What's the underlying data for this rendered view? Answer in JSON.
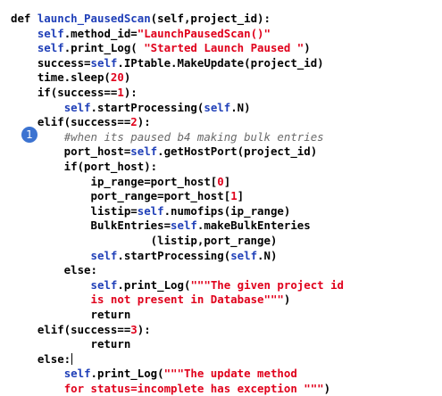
{
  "badge": {
    "label": "1",
    "color": "#3c73d1"
  },
  "colors": {
    "keyword": "#000000",
    "identifier": "#1f3fb8",
    "string": "#e0001b",
    "comment": "#6a6a6a"
  },
  "lines": [
    [
      {
        "t": "def ",
        "c": "kw"
      },
      {
        "t": "launch_PausedScan",
        "c": "fn"
      },
      {
        "t": "(self,project_id):",
        "c": "kw"
      }
    ],
    [
      {
        "t": "    ",
        "c": "kw"
      },
      {
        "t": "self",
        "c": "self"
      },
      {
        "t": ".method_id=",
        "c": "kw"
      },
      {
        "t": "\"LaunchPausedScan()\"",
        "c": "str"
      }
    ],
    [
      {
        "t": "    ",
        "c": "kw"
      },
      {
        "t": "self",
        "c": "self"
      },
      {
        "t": ".print_Log( ",
        "c": "kw"
      },
      {
        "t": "\"Started Launch Paused \"",
        "c": "str"
      },
      {
        "t": ")",
        "c": "kw"
      }
    ],
    [
      {
        "t": "    success=",
        "c": "kw"
      },
      {
        "t": "self",
        "c": "self"
      },
      {
        "t": ".IPtable.MakeUpdate(project_id)",
        "c": "kw"
      }
    ],
    [
      {
        "t": "    time.sleep(",
        "c": "kw"
      },
      {
        "t": "20",
        "c": "num"
      },
      {
        "t": ")",
        "c": "kw"
      }
    ],
    [
      {
        "t": "    if(success==",
        "c": "kw"
      },
      {
        "t": "1",
        "c": "num"
      },
      {
        "t": "):",
        "c": "kw"
      }
    ],
    [
      {
        "t": "        ",
        "c": "kw"
      },
      {
        "t": "self",
        "c": "self"
      },
      {
        "t": ".startProcessing(",
        "c": "kw"
      },
      {
        "t": "self",
        "c": "self"
      },
      {
        "t": ".N)",
        "c": "kw"
      }
    ],
    [
      {
        "t": "    elif(success==",
        "c": "kw"
      },
      {
        "t": "2",
        "c": "num"
      },
      {
        "t": "):",
        "c": "kw"
      }
    ],
    [
      {
        "t": "        ",
        "c": "kw"
      },
      {
        "t": "#when its paused b4 making bulk entries",
        "c": "cmt"
      }
    ],
    [
      {
        "t": "        port_host=",
        "c": "kw"
      },
      {
        "t": "self",
        "c": "self"
      },
      {
        "t": ".getHostPort(project_id)",
        "c": "kw"
      }
    ],
    [
      {
        "t": "        if(port_host):",
        "c": "kw"
      }
    ],
    [
      {
        "t": "            ip_range=port_host[",
        "c": "kw"
      },
      {
        "t": "0",
        "c": "num"
      },
      {
        "t": "]",
        "c": "kw"
      }
    ],
    [
      {
        "t": "            port_range=port_host[",
        "c": "kw"
      },
      {
        "t": "1",
        "c": "num"
      },
      {
        "t": "]",
        "c": "kw"
      }
    ],
    [
      {
        "t": "            listip=",
        "c": "kw"
      },
      {
        "t": "self",
        "c": "self"
      },
      {
        "t": ".numofips(ip_range)",
        "c": "kw"
      }
    ],
    [
      {
        "t": "            BulkEntries=",
        "c": "kw"
      },
      {
        "t": "self",
        "c": "self"
      },
      {
        "t": ".makeBulkEnteries",
        "c": "kw"
      }
    ],
    [
      {
        "t": "                     (listip,port_range)",
        "c": "kw"
      }
    ],
    [
      {
        "t": "            ",
        "c": "kw"
      },
      {
        "t": "self",
        "c": "self"
      },
      {
        "t": ".startProcessing(",
        "c": "kw"
      },
      {
        "t": "self",
        "c": "self"
      },
      {
        "t": ".N)",
        "c": "kw"
      }
    ],
    [
      {
        "t": "        else:",
        "c": "kw"
      }
    ],
    [
      {
        "t": "            ",
        "c": "kw"
      },
      {
        "t": "self",
        "c": "self"
      },
      {
        "t": ".print_Log(",
        "c": "kw"
      },
      {
        "t": "\"\"\"The given project id",
        "c": "str"
      }
    ],
    [
      {
        "t": "            ",
        "c": "kw"
      },
      {
        "t": "is not present in Database\"\"\"",
        "c": "str"
      },
      {
        "t": ")",
        "c": "kw"
      }
    ],
    [
      {
        "t": "            return",
        "c": "kw"
      }
    ],
    [
      {
        "t": "    elif(success==",
        "c": "kw"
      },
      {
        "t": "3",
        "c": "num"
      },
      {
        "t": "):",
        "c": "kw"
      }
    ],
    [
      {
        "t": "            return",
        "c": "kw"
      }
    ],
    [
      {
        "t": "    else:",
        "c": "kw"
      },
      {
        "t": "",
        "c": "cursor"
      }
    ],
    [
      {
        "t": "        ",
        "c": "kw"
      },
      {
        "t": "self",
        "c": "self"
      },
      {
        "t": ".print_Log(",
        "c": "kw"
      },
      {
        "t": "\"\"\"The update method",
        "c": "str"
      }
    ],
    [
      {
        "t": "        ",
        "c": "kw"
      },
      {
        "t": "for status=incomplete has exception \"\"\"",
        "c": "str"
      },
      {
        "t": ")",
        "c": "kw"
      }
    ]
  ]
}
